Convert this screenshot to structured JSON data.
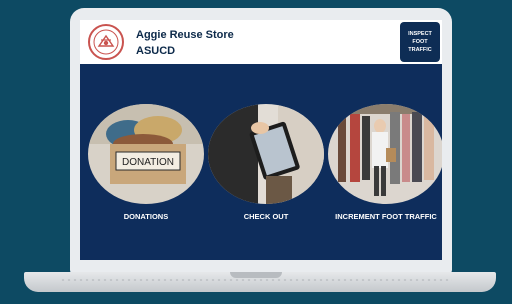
{
  "app": {
    "title": "Aggie Reuse Store",
    "subtitle": "ASUCD"
  },
  "header": {
    "inspect_button_label": "INSPECT FOOT TRAFFIC",
    "inspect_line1": "INSPECT",
    "inspect_line2": "FOOT",
    "inspect_line3": "TRAFFIC"
  },
  "tiles": [
    {
      "label": "DONATIONS",
      "image_text": "DONATION",
      "image": "donation-box-photo"
    },
    {
      "label": "CHECK OUT",
      "image": "tablet-checkout-photo"
    },
    {
      "label": "INCREMENT FOOT TRAFFIC",
      "image": "clothing-rack-photo"
    }
  ],
  "colors": {
    "background": "#0d4a63",
    "panel": "#0e2d5c",
    "button": "#0e2d55",
    "logo_accent": "#c9534f"
  }
}
